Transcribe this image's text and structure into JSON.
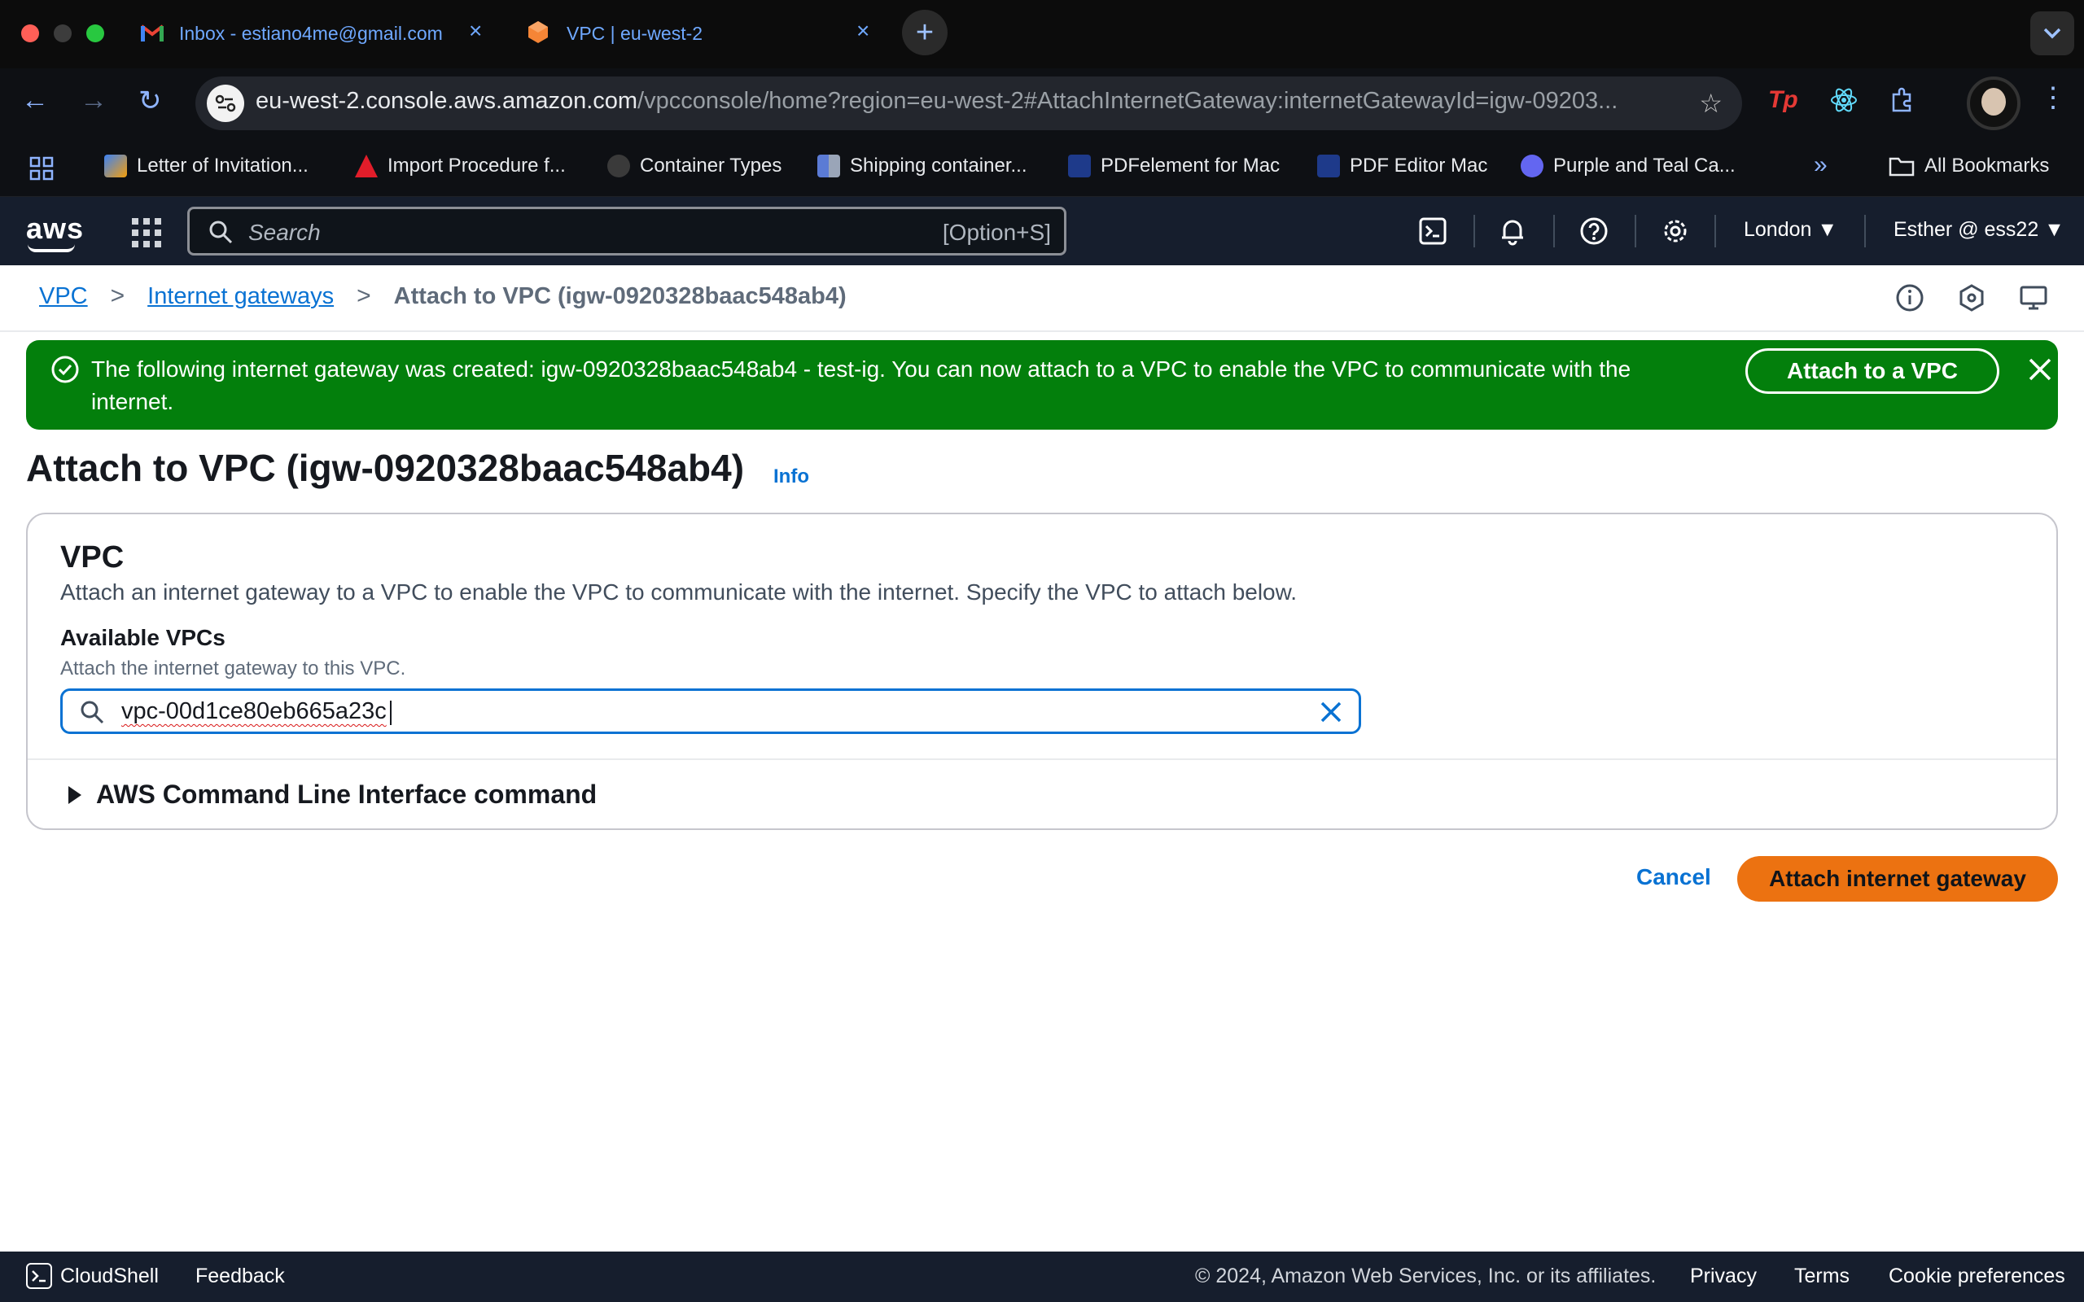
{
  "browser": {
    "tabs": [
      {
        "title": "Inbox - estiano4me@gmail.com",
        "active": false
      },
      {
        "title": "VPC | eu-west-2",
        "active": true
      }
    ],
    "url_host": "eu-west-2.console.aws.amazon.com",
    "url_path": "/vpcconsole/home?region=eu-west-2#AttachInternetGateway:internetGatewayId=igw-09203...",
    "bookmarks": [
      {
        "label": "Letter of Invitation..."
      },
      {
        "label": "Import Procedure f..."
      },
      {
        "label": "Container Types"
      },
      {
        "label": "Shipping container..."
      },
      {
        "label": "PDFelement for Mac"
      },
      {
        "label": "PDF Editor Mac"
      },
      {
        "label": "Purple and Teal Ca..."
      }
    ],
    "all_bookmarks": "All Bookmarks",
    "overflow": "»"
  },
  "aws_header": {
    "logo": "aws",
    "search_placeholder": "Search",
    "search_shortcut": "[Option+S]",
    "region": "London ▼",
    "account": "Esther @ ess22 ▼"
  },
  "breadcrumb": {
    "items": [
      "VPC",
      "Internet gateways"
    ],
    "current": "Attach to VPC (igw-0920328baac548ab4)",
    "separator": ">"
  },
  "flash": {
    "message": "The following internet gateway was created: igw-0920328baac548ab4 - test-ig. You can now attach to a VPC to enable the VPC to communicate with the internet.",
    "action": "Attach to a VPC",
    "color": "#037f0c"
  },
  "page": {
    "title": "Attach to VPC (igw-0920328baac548ab4)",
    "info": "Info"
  },
  "vpc_section": {
    "title": "VPC",
    "description": "Attach an internet gateway to a VPC to enable the VPC to communicate with the internet. Specify the VPC to attach below.",
    "field_label": "Available VPCs",
    "field_description": "Attach the internet gateway to this VPC.",
    "field_value": "vpc-00d1ce80eb665a23c",
    "cli_expander": "AWS Command Line Interface command"
  },
  "actions": {
    "cancel": "Cancel",
    "primary": "Attach internet gateway",
    "primary_color": "#ec7211"
  },
  "footer": {
    "cloudshell": "CloudShell",
    "feedback": "Feedback",
    "copyright": "© 2024, Amazon Web Services, Inc. or its affiliates.",
    "privacy": "Privacy",
    "terms": "Terms",
    "cookies": "Cookie preferences"
  }
}
